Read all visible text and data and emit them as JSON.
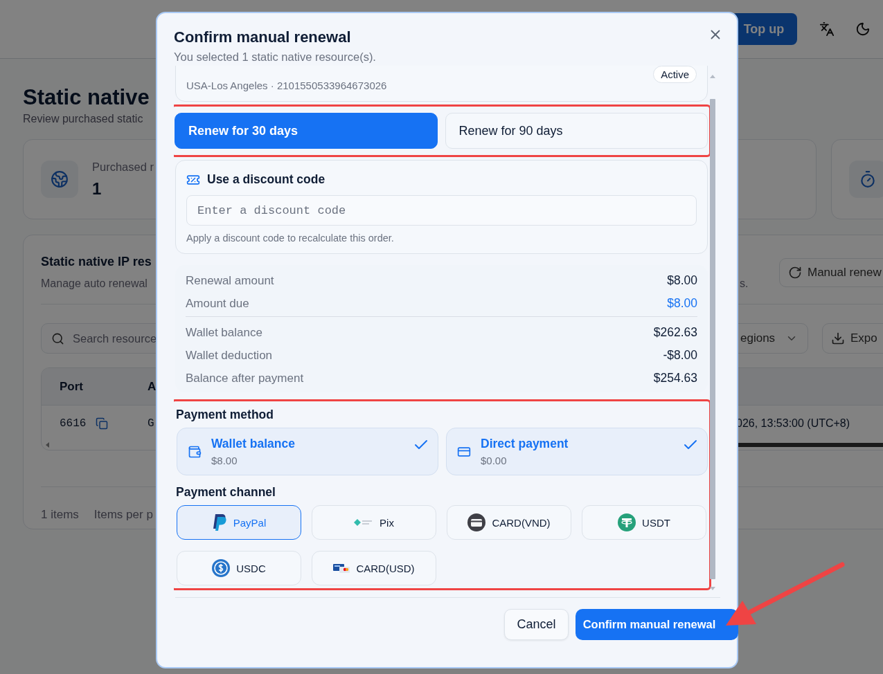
{
  "app_header": {
    "top_up": "Top up"
  },
  "page": {
    "title": "Static native",
    "subtitle": "Review purchased static"
  },
  "stats": [
    {
      "kind": "globe",
      "label": "Purchased r",
      "value": "1"
    },
    {
      "kind": "empty"
    },
    {
      "kind": "timer"
    }
  ],
  "resources": {
    "title": "Static native IP res",
    "subtitle": "Manage auto renewal",
    "subtitle_tail": "s.",
    "manual_renew": "Manual renew",
    "search_placeholder": "Search resource",
    "region_filter": "egions",
    "export": "Expo",
    "columns": [
      "Port",
      "A"
    ],
    "rows": [
      {
        "port": "6616",
        "column_2": "G",
        "column_3": "026, 13:53:00 (UTC+8)"
      }
    ],
    "count": "1 items",
    "per_page": "Items per p"
  },
  "dialog": {
    "title": "Confirm manual renewal",
    "subtitle": "You selected 1 static native resource(s).",
    "resource": {
      "details": "USA-Los Angeles · 2101550533964673026",
      "status": "Active"
    },
    "renew_options": {
      "highlighted": true,
      "items": [
        {
          "label": "Renew for 30 days",
          "selected": true
        },
        {
          "label": "Renew for 90 days",
          "selected": false
        }
      ]
    },
    "discount": {
      "title": "Use a discount code",
      "placeholder": "Enter a discount code",
      "hint": "Apply a discount code to recalculate this order."
    },
    "summary_totals": [
      {
        "label": "Renewal amount",
        "value": "$8.00",
        "highlighted": false
      },
      {
        "label": "Amount due",
        "value": "$8.00",
        "highlighted": true
      }
    ],
    "summary_wallet": [
      {
        "label": "Wallet balance",
        "value": "$262.63",
        "highlighted": false
      },
      {
        "label": "Wallet deduction",
        "value": "-$8.00",
        "highlighted": false
      },
      {
        "label": "Balance after payment",
        "value": "$254.63",
        "highlighted": false
      }
    ],
    "payment": {
      "highlighted": true,
      "method_label": "Payment method",
      "methods": [
        {
          "kind": "wallet",
          "title": "Wallet balance",
          "amount": "$8.00",
          "selected": true
        },
        {
          "kind": "card",
          "title": "Direct payment",
          "amount": "$0.00",
          "selected": true
        }
      ],
      "channel_label": "Payment channel",
      "channels": [
        {
          "kind": "paypal",
          "label": "PayPal",
          "selected": true
        },
        {
          "kind": "pix",
          "label": "Pix",
          "selected": false
        },
        {
          "kind": "card_vnd",
          "label": "CARD(VND)",
          "selected": false
        },
        {
          "kind": "usdt",
          "label": "USDT",
          "selected": false
        },
        {
          "kind": "usdc",
          "label": "USDC",
          "selected": false
        },
        {
          "kind": "card_usd",
          "label": "CARD(USD)",
          "selected": false
        }
      ]
    },
    "cancel": "Cancel",
    "confirm": "Confirm manual renewal",
    "confirm_pointed": true
  }
}
